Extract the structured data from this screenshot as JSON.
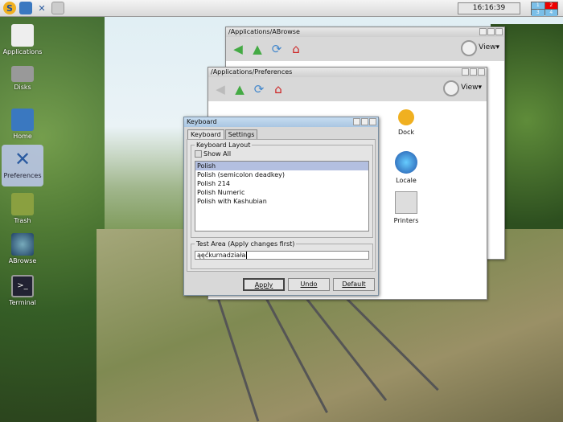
{
  "topbar": {
    "clock": "16:16:39",
    "pager": [
      "1",
      "2",
      "3",
      "4"
    ],
    "icons": [
      "dock-s-icon",
      "folder-icon",
      "preferences-icon",
      "printer-icon"
    ]
  },
  "desktop": [
    {
      "label": "Applications"
    },
    {
      "label": "Disks"
    },
    {
      "label": "Home"
    },
    {
      "label": "Preferences"
    },
    {
      "label": "Trash"
    },
    {
      "label": "ABrowse"
    },
    {
      "label": "Terminal"
    }
  ],
  "abrowse": {
    "title": "/Applications/ABrowse",
    "view": "View▾"
  },
  "prefs": {
    "title": "/Applications/Preferences",
    "view": "View▾",
    "items": [
      {
        "label": "Dock"
      },
      {
        "label": "Locale"
      },
      {
        "label": "Printers"
      }
    ]
  },
  "keyboard": {
    "title": "Keyboard",
    "tabs": [
      "Keyboard",
      "Settings"
    ],
    "layout_legend": "Keyboard Layout",
    "show_all": "Show All",
    "layouts": [
      "Polish",
      "Polish (semicolon deadkey)",
      "Polish 214",
      "Polish Numeric",
      "Polish with Kashubian"
    ],
    "test_legend": "Test Area (Apply changes first)",
    "test_value": "ąęćkurnadziała",
    "apply": "Apply",
    "undo": "Undo",
    "default": "Default"
  }
}
